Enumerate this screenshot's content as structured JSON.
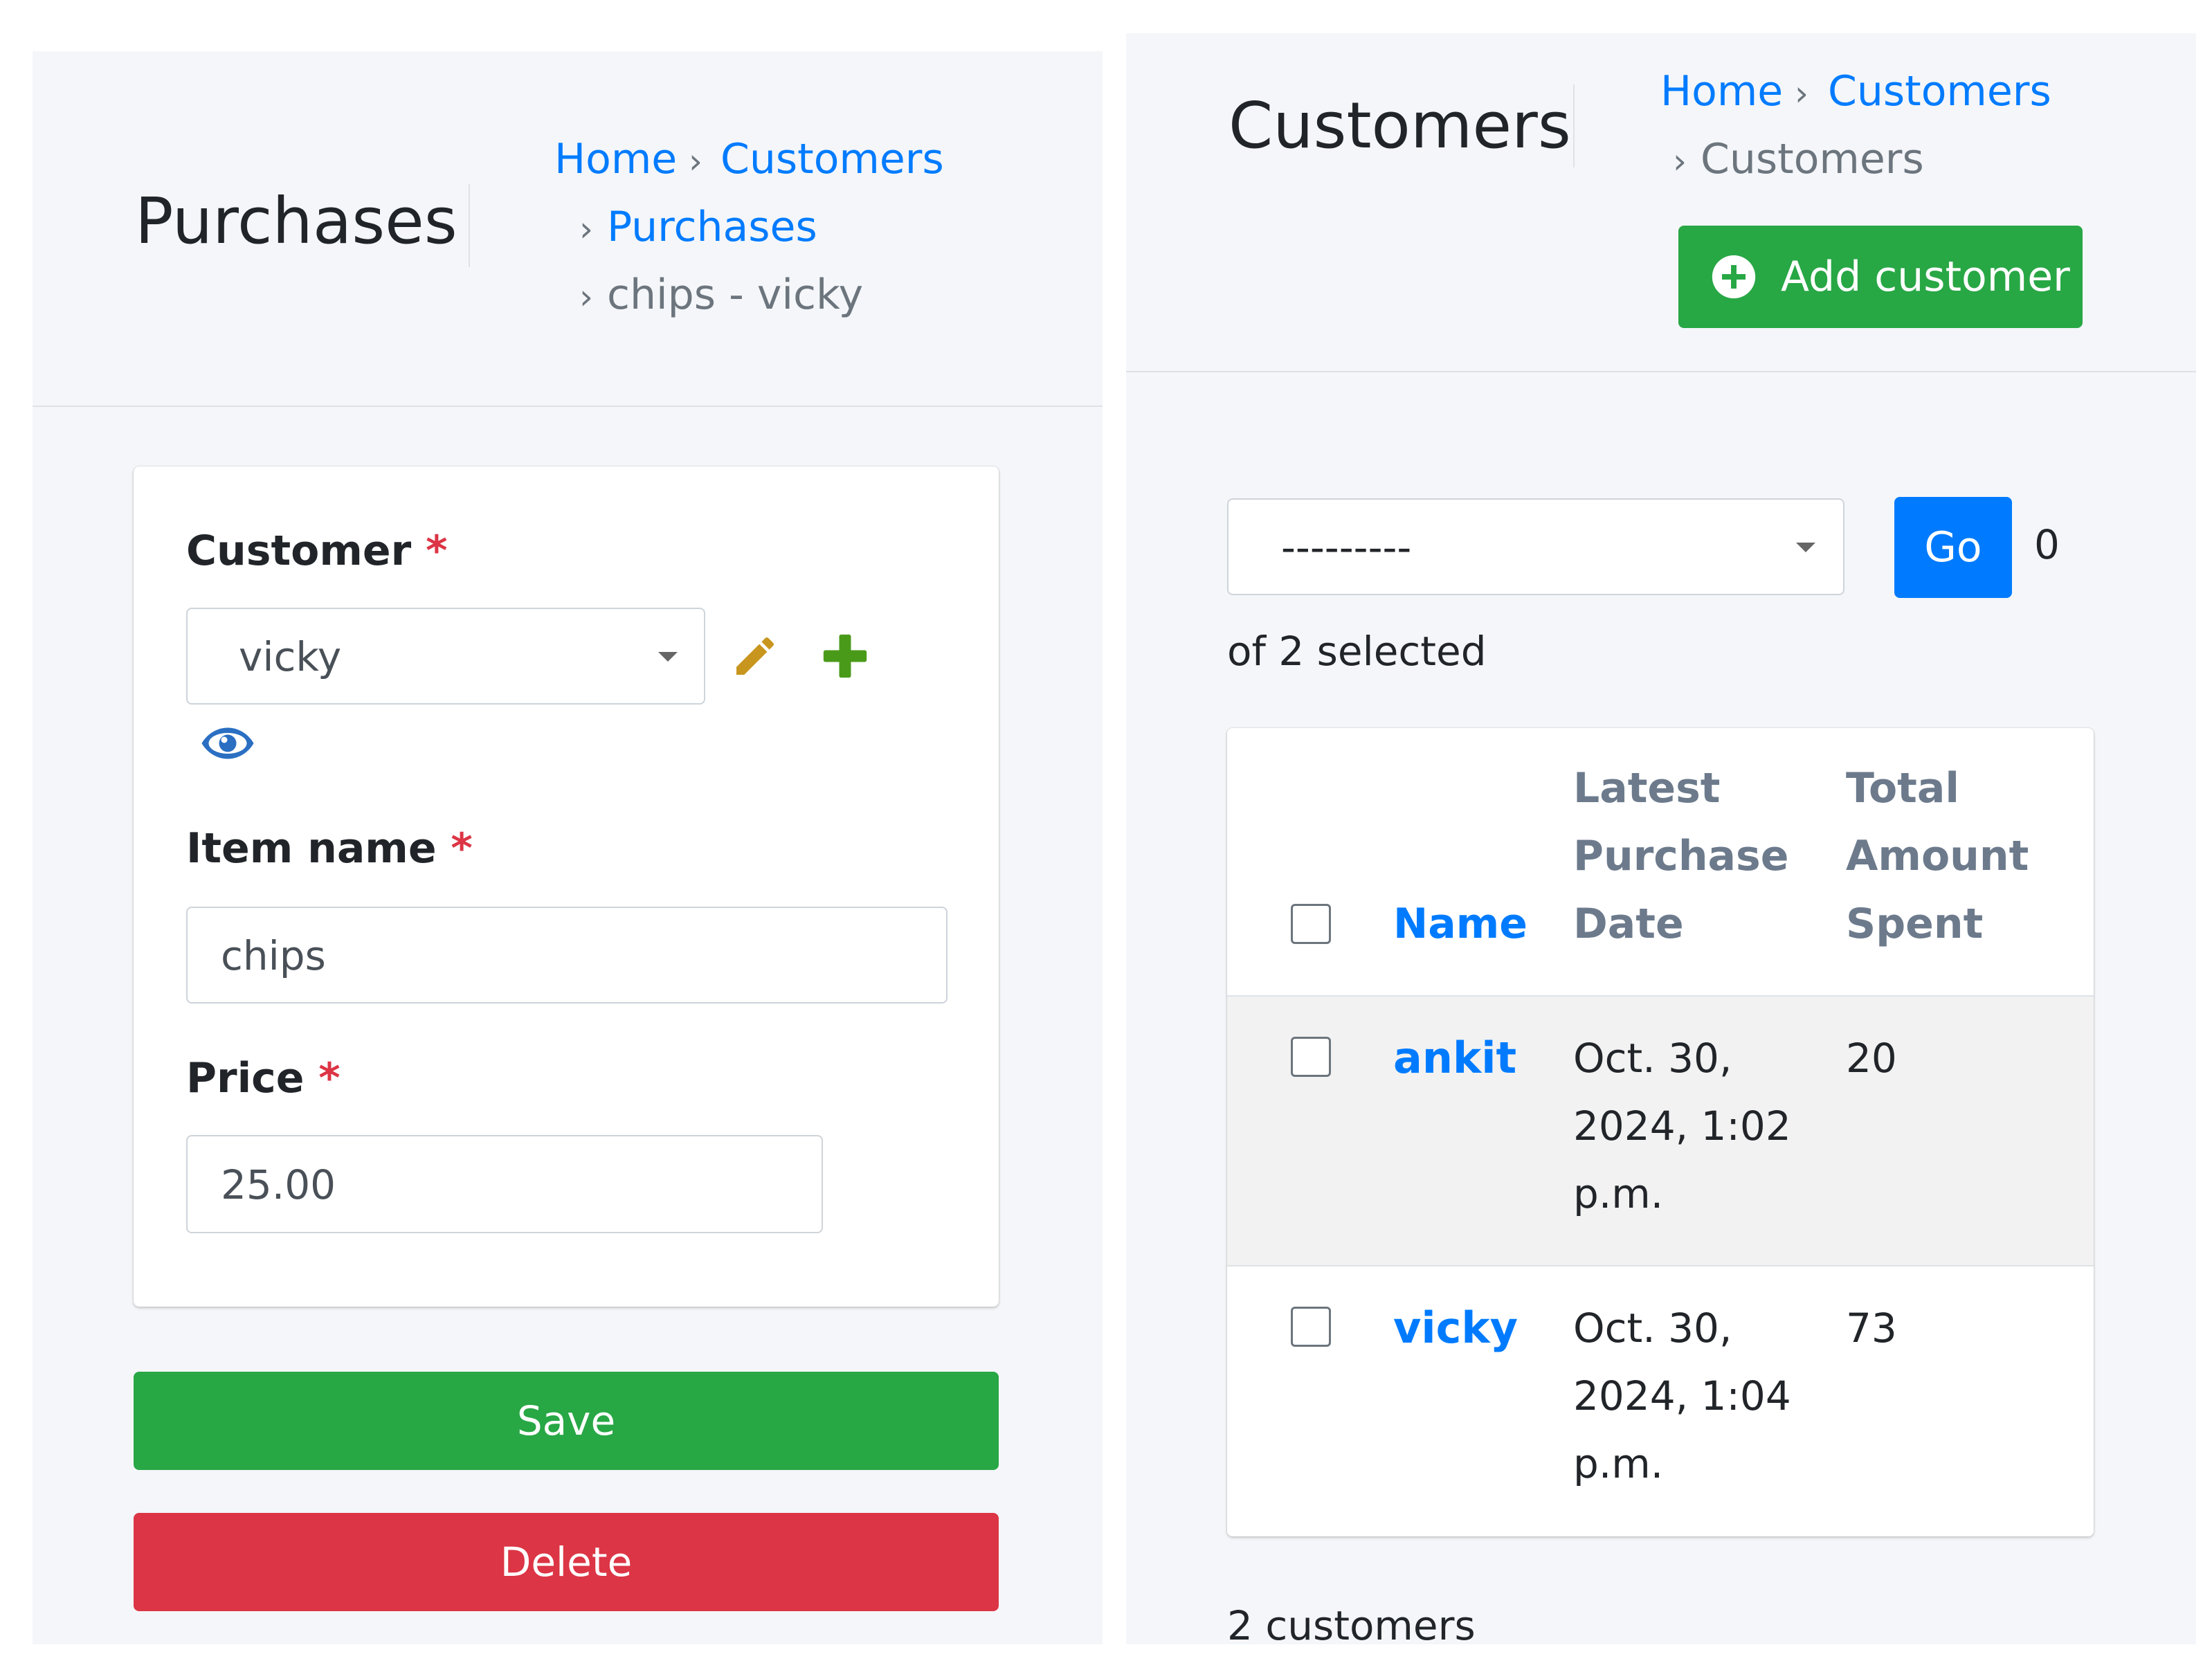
{
  "purchase_form": {
    "title": "Purchases",
    "breadcrumb": {
      "home": "Home",
      "customers": "Customers",
      "purchases": "Purchases",
      "current": "chips - vicky"
    },
    "separator": "›",
    "customer": {
      "label": "Customer",
      "required_mark": "*",
      "value": "vicky"
    },
    "item_name": {
      "label": "Item name",
      "required_mark": "*",
      "value": "chips"
    },
    "price": {
      "label": "Price",
      "required_mark": "*",
      "value": "25.00"
    },
    "save_label": "Save",
    "delete_label": "Delete"
  },
  "customer_list": {
    "title": "Customers",
    "breadcrumb": {
      "home": "Home",
      "app": "Customers",
      "current": "Customers"
    },
    "separator": "›",
    "add_label": "Add customer",
    "action_select_value": "---------",
    "go_label": "Go",
    "selected_count": "0",
    "selected_suffix": "of 2 selected",
    "columns": {
      "name": "Name",
      "latest_line1": "Latest",
      "latest_line2": "Purchase",
      "latest_line3": "Date",
      "total_line1": "Total",
      "total_line2": "Amount",
      "total_line3": "Spent"
    },
    "rows": [
      {
        "name": "ankit",
        "date_line1": "Oct. 30,",
        "date_line2": "2024, 1:02",
        "date_line3": "p.m.",
        "total": "20"
      },
      {
        "name": "vicky",
        "date_line1": "Oct. 30,",
        "date_line2": "2024, 1:04",
        "date_line3": "p.m.",
        "total": "73"
      }
    ],
    "count_text": "2 customers"
  },
  "colors": {
    "link": "#007bff",
    "success": "#28a745",
    "danger": "#dc3545",
    "edit_icon": "#c8961e",
    "add_icon": "#4a9a1a",
    "view_icon": "#2a6fc2"
  }
}
